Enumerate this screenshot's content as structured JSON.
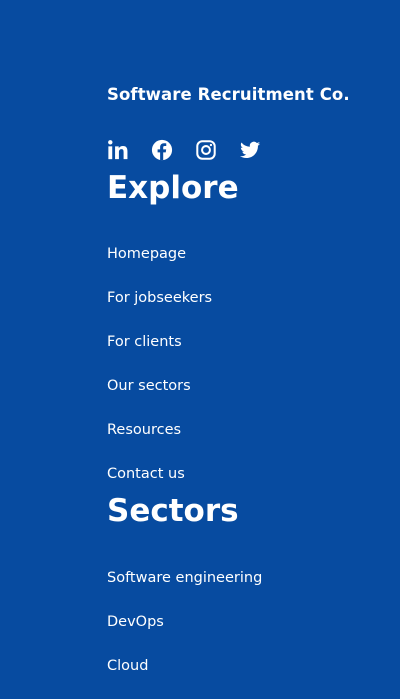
{
  "footer": {
    "brand": "Software Recruitment Co.",
    "social": [
      {
        "icon": "linkedin-icon"
      },
      {
        "icon": "facebook-icon"
      },
      {
        "icon": "instagram-icon"
      },
      {
        "icon": "twitter-icon"
      }
    ],
    "explore": {
      "heading": "Explore",
      "links": [
        "Homepage",
        "For jobseekers",
        "For clients",
        "Our sectors",
        "Resources",
        "Contact us"
      ]
    },
    "sectors": {
      "heading": "Sectors",
      "links": [
        "Software engineering",
        "DevOps",
        "Cloud"
      ]
    }
  },
  "colors": {
    "background": "#074ba0",
    "text": "#ffffff"
  }
}
